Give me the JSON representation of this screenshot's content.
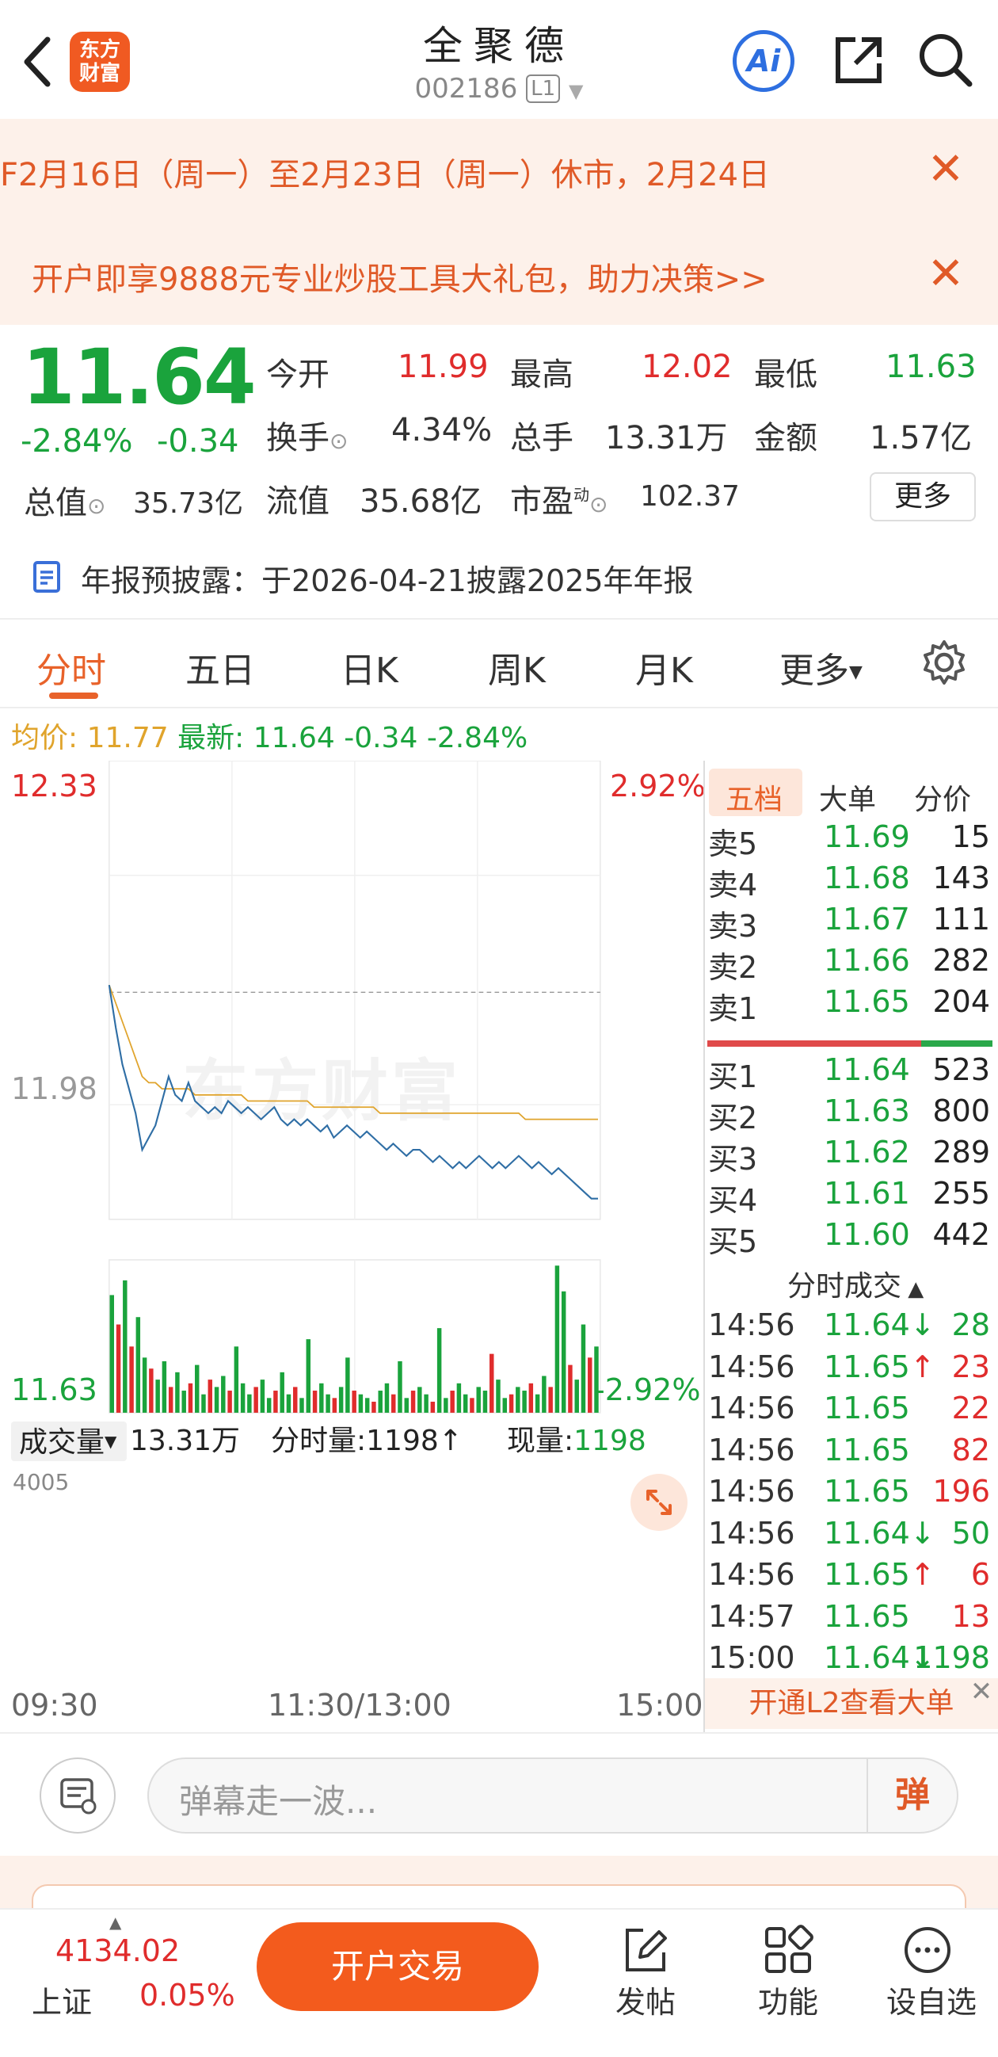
{
  "header": {
    "back_glyph": "‹",
    "logo_text": "东方\n财富",
    "title": "全聚德",
    "code": "002186",
    "level_badge": "L1",
    "ai_label": "Ai"
  },
  "notices": {
    "holiday": "F2月16日（周一）至2月23日（周一）休市，2月24日",
    "promo": "开户即享9888元专业炒股工具大礼包，助力决策>>",
    "close_glyph": "✕"
  },
  "quote": {
    "price": "11.64",
    "change_pct": "-2.84%",
    "change": "-0.34",
    "open_label": "今开",
    "open": "11.99",
    "high_label": "最高",
    "high": "12.02",
    "low_label": "最低",
    "low": "11.63",
    "turnover_label": "换手",
    "turnover": "4.34%",
    "volume_label": "总手",
    "volume": "13.31万",
    "amount_label": "金额",
    "amount": "1.57亿",
    "mktcap_label": "总值",
    "mktcap": "35.73亿",
    "float_label": "流值",
    "float": "35.68亿",
    "pe_label": "市盈",
    "pe_sup": "动",
    "pe": "102.37",
    "more_button": "更多"
  },
  "report": {
    "label": "年报预披露：",
    "text": "于2026-04-21披露2025年年报"
  },
  "tabs": [
    "分时",
    "五日",
    "日K",
    "周K",
    "月K",
    "更多"
  ],
  "chart_header": {
    "avg_label": "均价:",
    "avg": "11.77",
    "latest_label": "最新:",
    "latest": "11.64",
    "chg": "-0.34",
    "pct": "-2.84%"
  },
  "chart_data": {
    "type": "line",
    "y_top_label": "12.33",
    "y_bottom_label": "11.63",
    "pct_top_label": "2.92%",
    "pct_bottom_label": "-2.92%",
    "prev_close_label": "11.98",
    "ylim": [
      11.63,
      12.33
    ],
    "price_color": "#2f6ea5",
    "avg_color": "#e0a42c",
    "price_series": [
      11.99,
      11.92,
      11.86,
      11.82,
      11.78,
      11.72,
      11.74,
      11.76,
      11.8,
      11.84,
      11.81,
      11.8,
      11.83,
      11.8,
      11.79,
      11.78,
      11.79,
      11.78,
      11.8,
      11.79,
      11.78,
      11.79,
      11.78,
      11.77,
      11.78,
      11.79,
      11.77,
      11.76,
      11.77,
      11.76,
      11.77,
      11.76,
      11.75,
      11.76,
      11.74,
      11.75,
      11.76,
      11.75,
      11.74,
      11.75,
      11.74,
      11.73,
      11.72,
      11.73,
      11.72,
      11.71,
      11.72,
      11.72,
      11.71,
      11.7,
      11.71,
      11.7,
      11.69,
      11.7,
      11.69,
      11.7,
      11.71,
      11.7,
      11.69,
      11.7,
      11.69,
      11.7,
      11.71,
      11.7,
      11.69,
      11.7,
      11.69,
      11.68,
      11.69,
      11.68,
      11.67,
      11.66,
      11.65,
      11.64,
      11.64
    ],
    "avg_series": [
      11.99,
      11.96,
      11.93,
      11.9,
      11.87,
      11.84,
      11.83,
      11.83,
      11.82,
      11.82,
      11.82,
      11.82,
      11.82,
      11.81,
      11.81,
      11.81,
      11.81,
      11.81,
      11.81,
      11.81,
      11.81,
      11.8,
      11.8,
      11.8,
      11.8,
      11.8,
      11.8,
      11.8,
      11.8,
      11.8,
      11.8,
      11.79,
      11.79,
      11.79,
      11.79,
      11.79,
      11.79,
      11.79,
      11.79,
      11.79,
      11.79,
      11.78,
      11.78,
      11.78,
      11.78,
      11.78,
      11.78,
      11.78,
      11.78,
      11.78,
      11.78,
      11.78,
      11.78,
      11.78,
      11.78,
      11.78,
      11.78,
      11.78,
      11.78,
      11.78,
      11.78,
      11.78,
      11.78,
      11.77,
      11.77,
      11.77,
      11.77,
      11.77,
      11.77,
      11.77,
      11.77,
      11.77,
      11.77,
      11.77,
      11.77
    ],
    "x_labels": [
      "09:30",
      "11:30/13:00",
      "15:00"
    ],
    "volume": {
      "label": "成交量",
      "total": "13.31万",
      "minute_label": "分时量:",
      "minute": "1198",
      "now_label": "现量:",
      "now": "1198",
      "y_max_label": "4005",
      "bars": [
        3200,
        2400,
        3600,
        1800,
        2600,
        1500,
        1200,
        900,
        1400,
        700,
        1100,
        600,
        800,
        1300,
        500,
        900,
        700,
        1000,
        600,
        1800,
        800,
        500,
        700,
        900,
        400,
        600,
        1100,
        500,
        700,
        400,
        2000,
        600,
        800,
        500,
        400,
        700,
        1500,
        600,
        500,
        400,
        300,
        600,
        800,
        500,
        1400,
        400,
        600,
        700,
        500,
        300,
        2300,
        400,
        600,
        800,
        500,
        400,
        700,
        600,
        1600,
        900,
        400,
        500,
        700,
        600,
        800,
        500,
        1000,
        700,
        4000,
        3300,
        1300,
        900,
        2400,
        1500,
        1800
      ],
      "bar_colors_red_idx": [
        1,
        3,
        6,
        9,
        12,
        15,
        18,
        22,
        25,
        28,
        31,
        34,
        37,
        40,
        43,
        46,
        49,
        52,
        55,
        58,
        61,
        64,
        67,
        70,
        73
      ]
    }
  },
  "order_book": {
    "tabs": [
      "五档",
      "大单",
      "分价"
    ],
    "asks": [
      {
        "label": "卖5",
        "price": "11.69",
        "vol": "15"
      },
      {
        "label": "卖4",
        "price": "11.68",
        "vol": "143"
      },
      {
        "label": "卖3",
        "price": "11.67",
        "vol": "111"
      },
      {
        "label": "卖2",
        "price": "11.66",
        "vol": "282"
      },
      {
        "label": "卖1",
        "price": "11.65",
        "vol": "204"
      }
    ],
    "bids": [
      {
        "label": "买1",
        "price": "11.64",
        "vol": "523"
      },
      {
        "label": "买2",
        "price": "11.63",
        "vol": "800"
      },
      {
        "label": "买3",
        "price": "11.62",
        "vol": "289"
      },
      {
        "label": "买4",
        "price": "11.61",
        "vol": "255"
      },
      {
        "label": "买5",
        "price": "11.60",
        "vol": "442"
      }
    ],
    "ticks_title": "分时成交",
    "ticks": [
      {
        "time": "14:56",
        "price": "11.64↓",
        "vol": "28",
        "dir": "down"
      },
      {
        "time": "14:56",
        "price": "11.65↑",
        "vol": "23",
        "dir": "up"
      },
      {
        "time": "14:56",
        "price": "11.65",
        "vol": "22",
        "dir": "up"
      },
      {
        "time": "14:56",
        "price": "11.65",
        "vol": "82",
        "dir": "up"
      },
      {
        "time": "14:56",
        "price": "11.65",
        "vol": "196",
        "dir": "up"
      },
      {
        "time": "14:56",
        "price": "11.64↓",
        "vol": "50",
        "dir": "down"
      },
      {
        "time": "14:56",
        "price": "11.65↑",
        "vol": "6",
        "dir": "up"
      },
      {
        "time": "14:57",
        "price": "11.65",
        "vol": "13",
        "dir": "up"
      },
      {
        "time": "15:00",
        "price": "11.64↓",
        "vol": "1198",
        "dir": "down"
      }
    ],
    "l2_button": "开通L2查看大单"
  },
  "watermark": "东方财富",
  "danmu": {
    "placeholder": "弹幕走一波...",
    "send": "弹"
  },
  "bottom": {
    "index_value": "4134.02",
    "index_name": "上证",
    "index_pct": "0.05%",
    "trade_button": "开户交易",
    "nav": [
      "发帖",
      "功能",
      "设自选"
    ]
  }
}
